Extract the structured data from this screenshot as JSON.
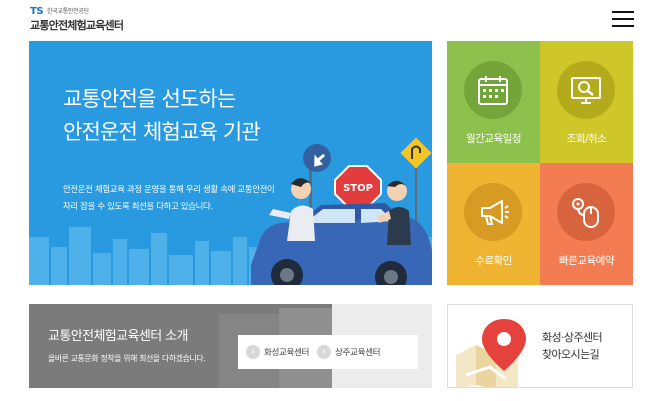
{
  "header": {
    "logo_mark": "TS",
    "logo_org": "한국교통안전공단",
    "logo_name": "교통안전체험교육센터"
  },
  "hero": {
    "title_line1": "교통안전을 선도하는",
    "title_line2": "안전운전 체험교육 기관",
    "desc_line1": "안전운전 체험교육 과정 운영을 통해 우리 생활 속에 교통안전이",
    "desc_line2": "자리 잡을 수 있도록 최선을 다하고 있습니다.",
    "stop_sign": "STOP",
    "colors": {
      "background": "#2a9ae0"
    }
  },
  "tiles": [
    {
      "label": "월간교육일정",
      "icon": "calendar-icon",
      "color": "#8dc04c"
    },
    {
      "label": "조회/취소",
      "icon": "search-monitor-icon",
      "color": "#cfc62a"
    },
    {
      "label": "수료확인",
      "icon": "megaphone-icon",
      "color": "#f0b433"
    },
    {
      "label": "빠른교육예약",
      "icon": "mouse-click-icon",
      "color": "#f37c53"
    }
  ],
  "intro": {
    "title": "교통안전체험교육센터 소개",
    "desc": "올바른 교통문화 정착을 위해 최선을 다하겠습니다.",
    "buttons": [
      "화성교육센터",
      "상주교육센터"
    ]
  },
  "directions": {
    "line1": "화성·상주센터",
    "line2": "찾아오시는길",
    "icon": "map-pin-icon"
  }
}
